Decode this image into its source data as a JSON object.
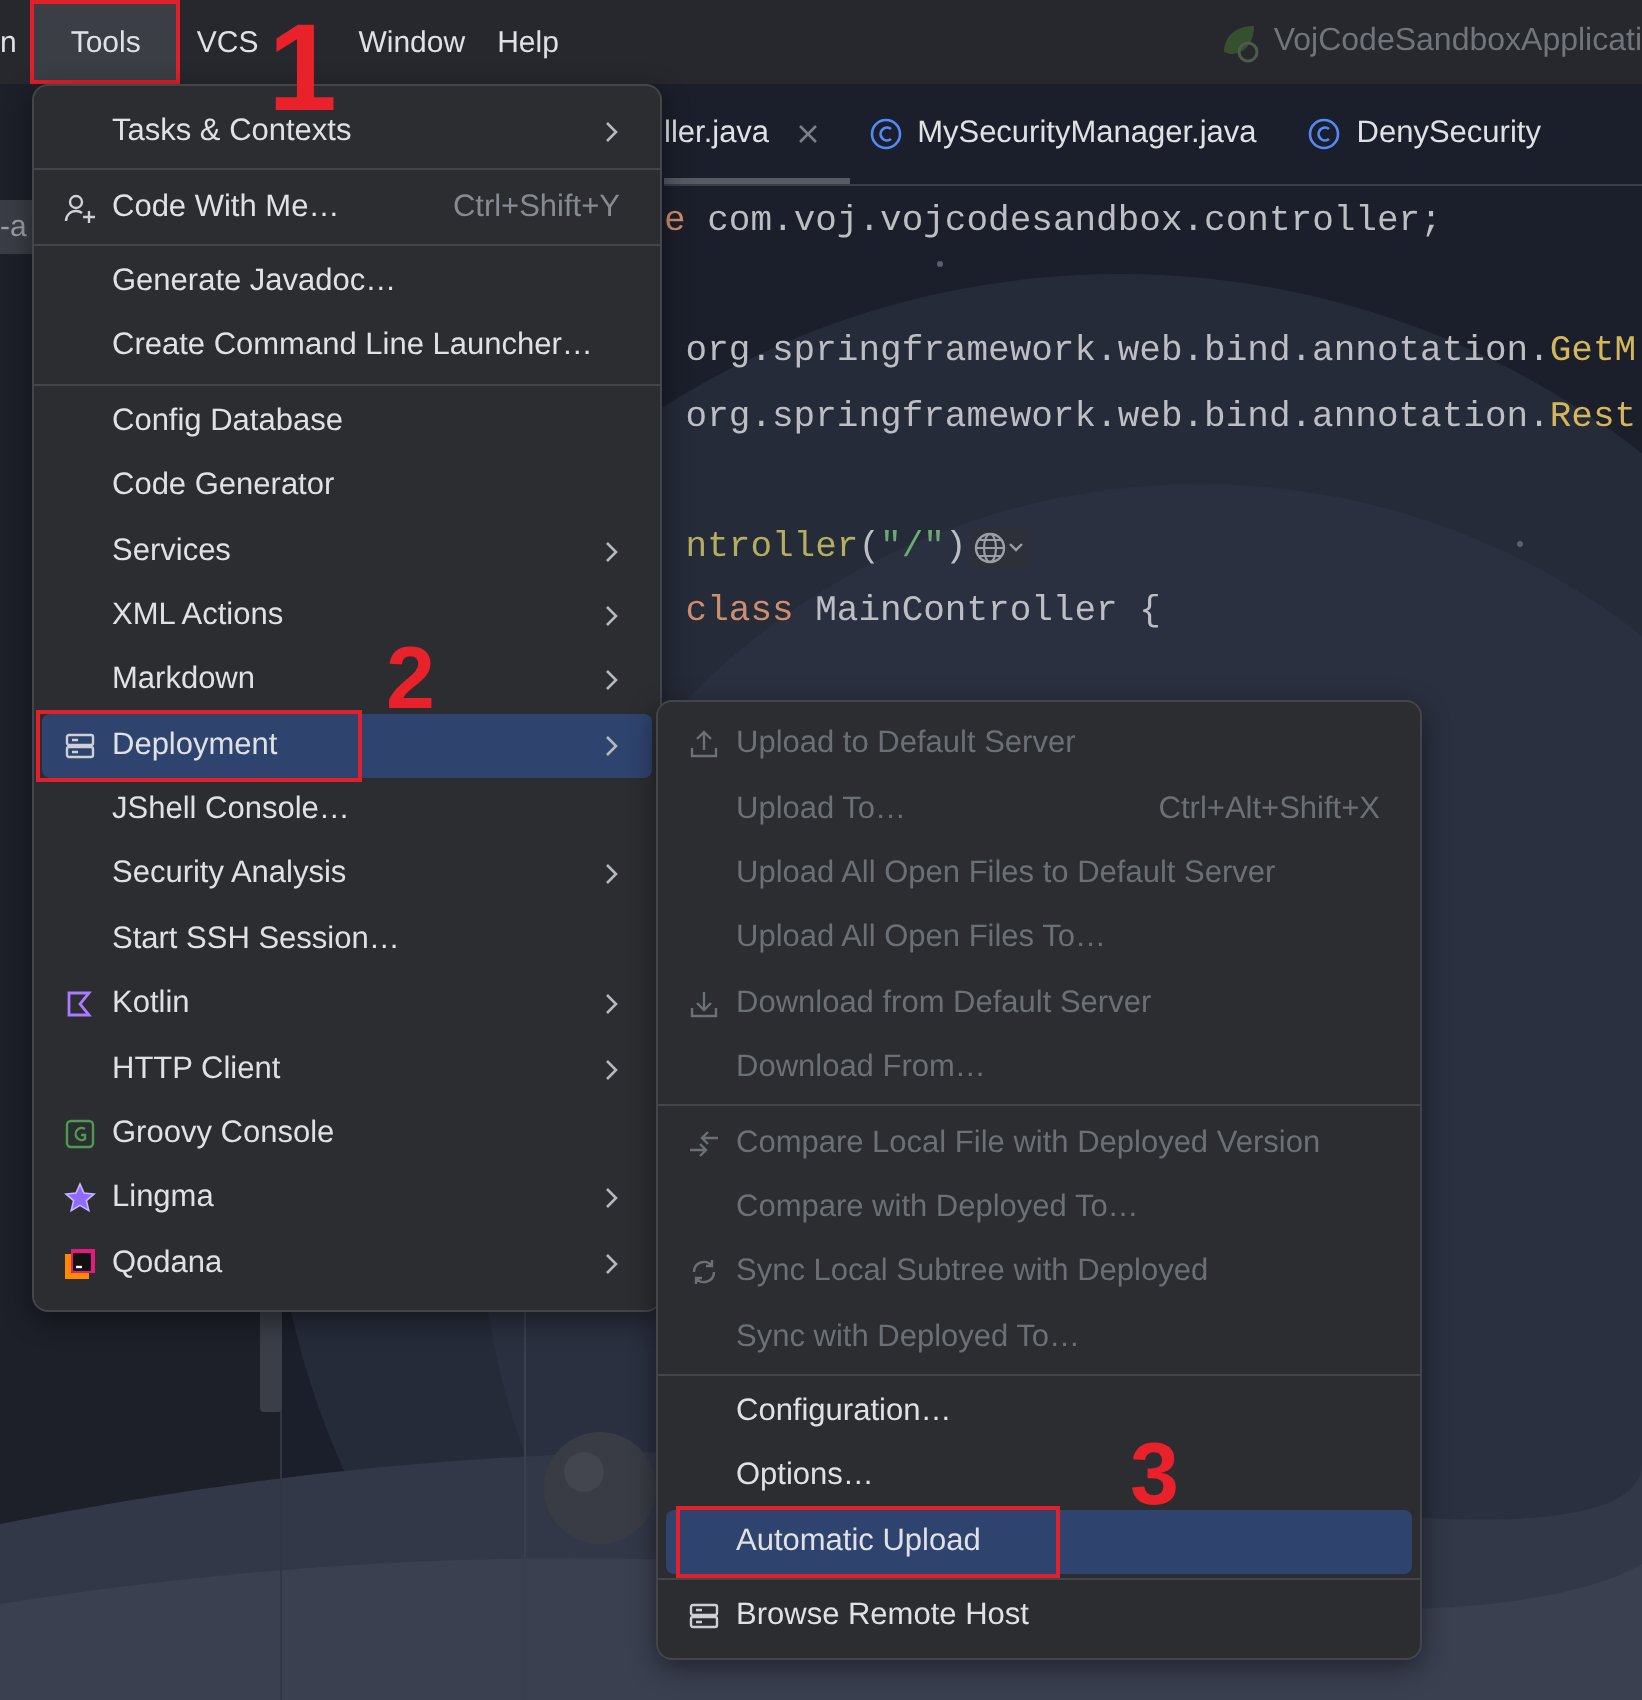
{
  "menu_bar": {
    "items": [
      {
        "label": "n",
        "selected": false,
        "outlined": false
      },
      {
        "label": "Tools",
        "selected": true,
        "outlined": true
      },
      {
        "label": "VCS",
        "selected": false,
        "outlined": false
      },
      {
        "label": "Window",
        "selected": false,
        "outlined": false
      },
      {
        "label": "Help",
        "selected": false,
        "outlined": false
      }
    ],
    "run_configuration": "VojCodeSandboxApplicati"
  },
  "project_panel": {
    "label": "-a"
  },
  "editor": {
    "tabs": [
      {
        "label": "ller.java",
        "closable": true,
        "selected": true
      },
      {
        "label": "MySecurityManager.java",
        "closable": false,
        "selected": false
      },
      {
        "label": "DenySecurity",
        "closable": false,
        "selected": false
      }
    ],
    "code_blocks": [
      [
        {
          "endpoint_hint": false,
          "tokens": [
            {
              "kind": "keyword",
              "text": "e"
            },
            {
              "kind": "plain",
              "text": " com.voj.vojcodesandbox.controller;"
            }
          ]
        }
      ],
      [
        {
          "endpoint_hint": false,
          "tokens": [
            {
              "kind": "plain",
              "text": " org.springframework.web.bind.annotation."
            },
            {
              "kind": "class",
              "text": "GetM"
            }
          ]
        },
        {
          "endpoint_hint": false,
          "tokens": [
            {
              "kind": "plain",
              "text": " org.springframework.web.bind.annotation."
            },
            {
              "kind": "class",
              "text": "Rest"
            }
          ]
        }
      ],
      [
        {
          "endpoint_hint": true,
          "tokens": [
            {
              "kind": "annotation",
              "text": " ntroller"
            },
            {
              "kind": "plain",
              "text": "("
            },
            {
              "kind": "string",
              "text": "\"/\""
            },
            {
              "kind": "plain",
              "text": ")"
            }
          ]
        },
        {
          "endpoint_hint": false,
          "tokens": [
            {
              "kind": "keyword",
              "text": " class"
            },
            {
              "kind": "plain",
              "text": " MainController {"
            }
          ]
        }
      ]
    ]
  },
  "tools_menu": {
    "sections": [
      [
        {
          "label": "Tasks & Contexts",
          "submenu": true,
          "selected": false,
          "outlined": false
        }
      ],
      [
        {
          "label": "Code With Me…",
          "shortcut": "Ctrl+Shift+Y",
          "submenu": false,
          "selected": false,
          "outlined": false
        }
      ],
      [
        {
          "label": "Generate Javadoc…",
          "submenu": false,
          "selected": false,
          "outlined": false
        },
        {
          "label": "Create Command Line Launcher…",
          "submenu": false,
          "selected": false,
          "outlined": false
        }
      ],
      [
        {
          "label": "Config Database",
          "submenu": false,
          "selected": false,
          "outlined": false
        },
        {
          "label": "Code Generator",
          "submenu": false,
          "selected": false,
          "outlined": false
        },
        {
          "label": "Services",
          "submenu": true,
          "selected": false,
          "outlined": false
        },
        {
          "label": "XML Actions",
          "submenu": true,
          "selected": false,
          "outlined": false
        },
        {
          "label": "Markdown",
          "submenu": true,
          "selected": false,
          "outlined": false
        },
        {
          "label": "Deployment",
          "submenu": true,
          "selected": true,
          "outlined": true
        },
        {
          "label": "JShell Console…",
          "submenu": false,
          "selected": false,
          "outlined": false
        },
        {
          "label": "Security Analysis",
          "submenu": true,
          "selected": false,
          "outlined": false
        },
        {
          "label": "Start SSH Session…",
          "submenu": false,
          "selected": false,
          "outlined": false
        },
        {
          "label": "Kotlin",
          "submenu": true,
          "selected": false,
          "outlined": false
        },
        {
          "label": "HTTP Client",
          "submenu": true,
          "selected": false,
          "outlined": false
        },
        {
          "label": "Groovy Console",
          "submenu": false,
          "selected": false,
          "outlined": false
        },
        {
          "label": "Lingma",
          "submenu": true,
          "selected": false,
          "outlined": false
        },
        {
          "label": "Qodana",
          "submenu": true,
          "selected": false,
          "outlined": false
        }
      ]
    ]
  },
  "deployment_submenu": {
    "sections": [
      [
        {
          "label": "Upload to Default Server",
          "disabled": true,
          "selected": false,
          "outlined": false
        },
        {
          "label": "Upload To…",
          "shortcut": "Ctrl+Alt+Shift+X",
          "disabled": true,
          "selected": false,
          "outlined": false
        },
        {
          "label": "Upload All Open Files to Default Server",
          "disabled": true,
          "selected": false,
          "outlined": false
        },
        {
          "label": "Upload All Open Files To…",
          "disabled": true,
          "selected": false,
          "outlined": false
        },
        {
          "label": "Download from Default Server",
          "disabled": true,
          "selected": false,
          "outlined": false
        },
        {
          "label": "Download From…",
          "disabled": true,
          "selected": false,
          "outlined": false
        }
      ],
      [
        {
          "label": "Compare Local File with Deployed Version",
          "disabled": true,
          "selected": false,
          "outlined": false
        },
        {
          "label": "Compare with Deployed To…",
          "disabled": true,
          "selected": false,
          "outlined": false
        },
        {
          "label": "Sync Local Subtree with Deployed",
          "disabled": true,
          "selected": false,
          "outlined": false
        },
        {
          "label": "Sync with Deployed To…",
          "disabled": true,
          "selected": false,
          "outlined": false
        }
      ],
      [
        {
          "label": "Configuration…",
          "disabled": false,
          "selected": false,
          "outlined": false
        },
        {
          "label": "Options…",
          "disabled": false,
          "selected": false,
          "outlined": false
        },
        {
          "label": "Automatic Upload",
          "disabled": false,
          "selected": true,
          "outlined": true
        }
      ],
      [
        {
          "label": "Browse Remote Host",
          "disabled": false,
          "selected": false,
          "outlined": false
        }
      ]
    ]
  },
  "annotations": [
    {
      "text": "1"
    },
    {
      "text": "2"
    },
    {
      "text": "3"
    }
  ]
}
